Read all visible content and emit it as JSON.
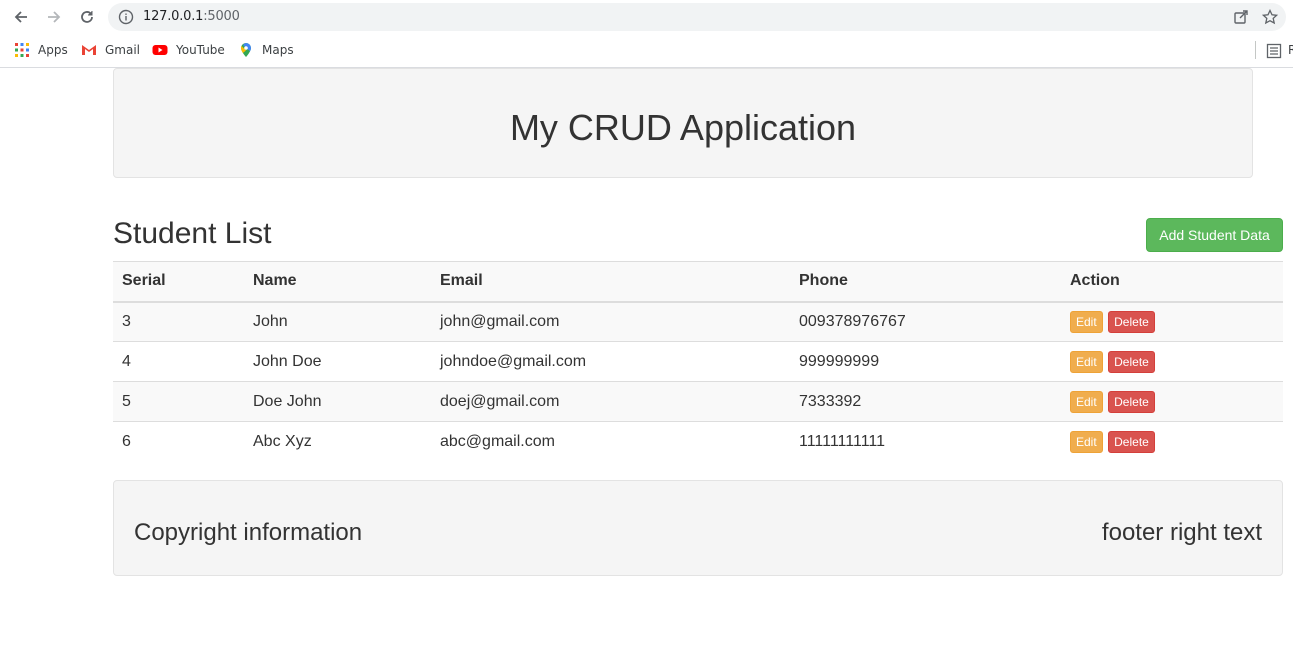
{
  "browser": {
    "url_host": "127.0.0.1",
    "url_port": ":5000",
    "bookmarks": [
      {
        "label": "Apps",
        "icon": "apps-grid-icon"
      },
      {
        "label": "Gmail",
        "icon": "gmail-icon"
      },
      {
        "label": "YouTube",
        "icon": "youtube-icon"
      },
      {
        "label": "Maps",
        "icon": "maps-pin-icon"
      }
    ],
    "reading_list_letter": "R"
  },
  "header": {
    "title": "My CRUD Application"
  },
  "main": {
    "title": "Student List",
    "add_button": "Add Student Data",
    "columns": [
      "Serial",
      "Name",
      "Email",
      "Phone",
      "Action"
    ],
    "rows": [
      {
        "serial": "3",
        "name": "John",
        "email": "john@gmail.com",
        "phone": "009378976767"
      },
      {
        "serial": "4",
        "name": "John Doe",
        "email": "johndoe@gmail.com",
        "phone": "999999999"
      },
      {
        "serial": "5",
        "name": "Doe John",
        "email": "doej@gmail.com",
        "phone": "7333392"
      },
      {
        "serial": "6",
        "name": "Abc Xyz",
        "email": "abc@gmail.com",
        "phone": "11111111111"
      }
    ],
    "edit_label": "Edit",
    "delete_label": "Delete"
  },
  "footer": {
    "left": "Copyright information",
    "right": "footer right text"
  },
  "colors": {
    "add": "#5cb85c",
    "edit": "#f0ad4e",
    "delete": "#d9534f"
  }
}
